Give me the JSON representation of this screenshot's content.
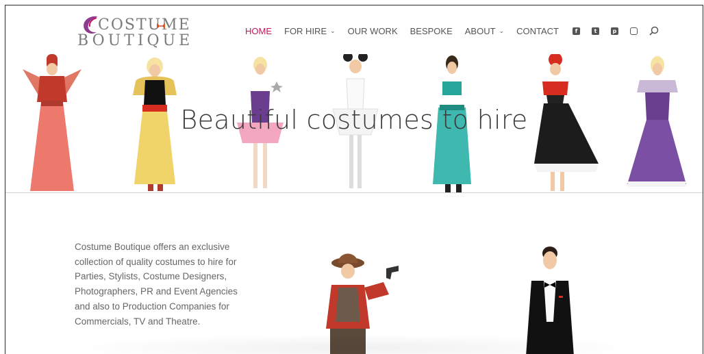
{
  "brand": {
    "logo_line1": "COSTUME",
    "logo_line2": "BOUTIQUE",
    "accent_color": "#c2185b",
    "logo_purple": "#8e3a8f"
  },
  "nav": {
    "items": [
      {
        "label": "HOME",
        "active": true,
        "dropdown": false
      },
      {
        "label": "FOR HIRE",
        "active": false,
        "dropdown": true
      },
      {
        "label": "OUR WORK",
        "active": false,
        "dropdown": false
      },
      {
        "label": "BESPOKE",
        "active": false,
        "dropdown": false
      },
      {
        "label": "ABOUT",
        "active": false,
        "dropdown": true
      },
      {
        "label": "CONTACT",
        "active": false,
        "dropdown": false
      }
    ],
    "social_icons": [
      "facebook-icon",
      "twitter-icon",
      "pinterest-icon",
      "instagram-icon"
    ],
    "search_icon": "search-icon"
  },
  "hero": {
    "title": "Beautiful costumes to hire"
  },
  "about": {
    "text": "Costume Boutique offers an exclusive collection of quality costumes to hire for Parties, Stylists, Costume Designers, Photographers, PR and Event Agencies and also to Production Companies for Commercials, TV and Theatre."
  }
}
